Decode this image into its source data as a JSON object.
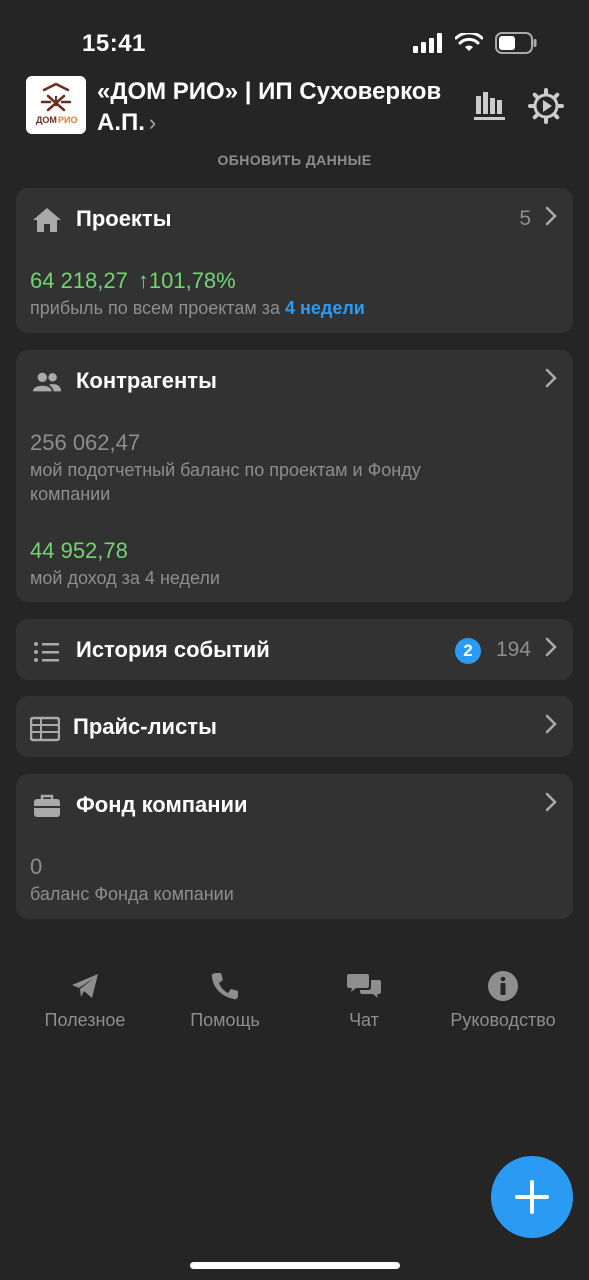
{
  "status": {
    "time": "15:41"
  },
  "header": {
    "org_name": "«ДОМ РИО» | ИП Суховерков А.П.",
    "org_chevron": "›",
    "logo_text_a": "ДОМ",
    "logo_text_b": "РИО",
    "refresh": "ОБНОВИТЬ ДАННЫЕ"
  },
  "projects": {
    "title": "Проекты",
    "count": "5",
    "profit": "64 218,27",
    "growth": "↑101,78%",
    "caption": "прибыль по всем проектам за ",
    "period": "4 недели"
  },
  "contractors": {
    "title": "Контрагенты",
    "balance": "256 062,47",
    "balance_caption": "мой подотчетный баланс по проектам и Фонду компании",
    "income": "44 952,78",
    "income_caption": "мой доход за 4 недели"
  },
  "history": {
    "title": "История событий",
    "badge": "2",
    "count": "194"
  },
  "pricelists": {
    "title": "Прайс-листы"
  },
  "fund": {
    "title": "Фонд компании",
    "balance": "0",
    "caption": "баланс Фонда компании"
  },
  "nav": [
    {
      "label": "Полезное",
      "icon": "telegram-icon"
    },
    {
      "label": "Помощь",
      "icon": "phone-icon"
    },
    {
      "label": "Чат",
      "icon": "chat-icon"
    },
    {
      "label": "Руководство",
      "icon": "info-icon"
    }
  ],
  "colors": {
    "accent": "#2b9af3",
    "positive": "#72d472",
    "card": "#323232",
    "background": "#252525"
  }
}
